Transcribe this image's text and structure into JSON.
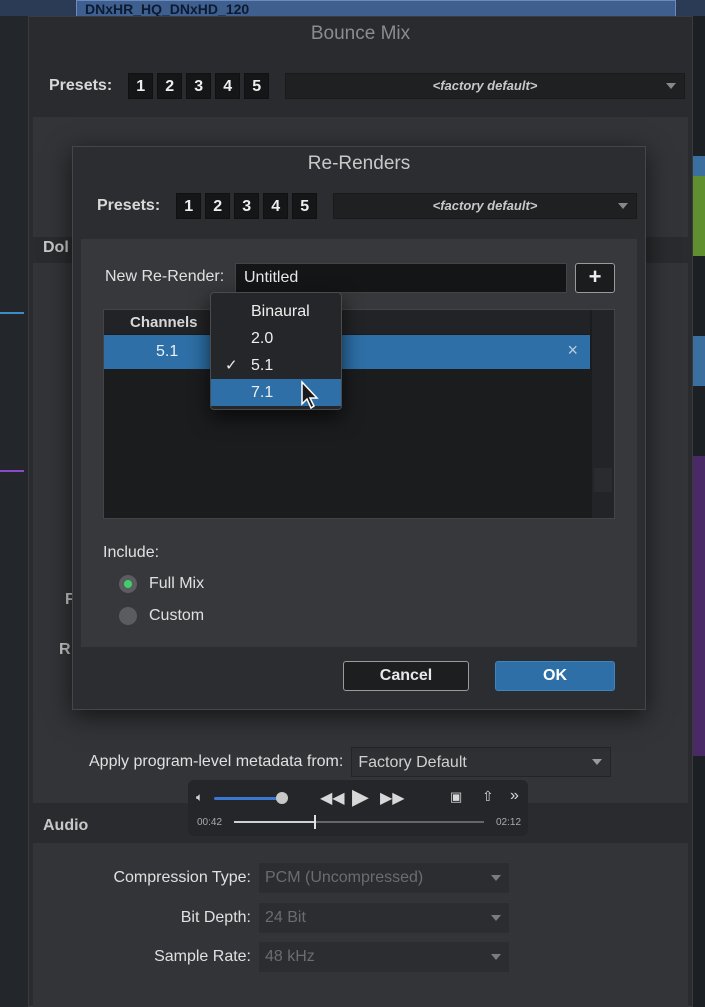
{
  "background": {
    "clip_label": "DNxHR_HQ_DNxHD_120"
  },
  "bounce_mix": {
    "title": "Bounce Mix",
    "presets_label": "Presets:",
    "preset_numbers": [
      "1",
      "2",
      "3",
      "4",
      "5"
    ],
    "preset_value": "<factory default>",
    "section_dolby_partial": "Dol",
    "apply_metadata_label": "Apply program-level metadata from:",
    "apply_metadata_value": "Factory Default",
    "audio_section": "Audio",
    "compression_label": "Compression Type:",
    "compression_value": "PCM (Uncompressed)",
    "bit_depth_label": "Bit Depth:",
    "bit_depth_value": "24 Bit",
    "sample_rate_label": "Sample Rate:",
    "sample_rate_value": "48 kHz",
    "partial_labels": [
      "F",
      "R"
    ]
  },
  "player": {
    "current_time": "00:42",
    "total_time": "02:12",
    "progress_fraction": 0.32,
    "volume_fraction": 0.9
  },
  "re_renders": {
    "title": "Re-Renders",
    "presets_label": "Presets:",
    "preset_numbers": [
      "1",
      "2",
      "3",
      "4",
      "5"
    ],
    "preset_value": "<factory default>",
    "new_label": "New Re-Render:",
    "new_value": "Untitled",
    "add_symbol": "+",
    "channels_header": "Channels",
    "row_value": "5.1",
    "remove_symbol": "×",
    "include_label": "Include:",
    "options": [
      {
        "label": "Full Mix",
        "selected": true
      },
      {
        "label": "Custom",
        "selected": false
      }
    ],
    "cancel_label": "Cancel",
    "ok_label": "OK"
  },
  "channel_menu": {
    "items": [
      {
        "label": "Binaural",
        "checked": false,
        "highlighted": false
      },
      {
        "label": "2.0",
        "checked": false,
        "highlighted": false
      },
      {
        "label": "5.1",
        "checked": true,
        "highlighted": false
      },
      {
        "label": "7.1",
        "checked": false,
        "highlighted": true
      }
    ],
    "check_mark": "✓"
  },
  "colors": {
    "accent": "#2d6fa6",
    "radio_on": "#3fd068"
  }
}
